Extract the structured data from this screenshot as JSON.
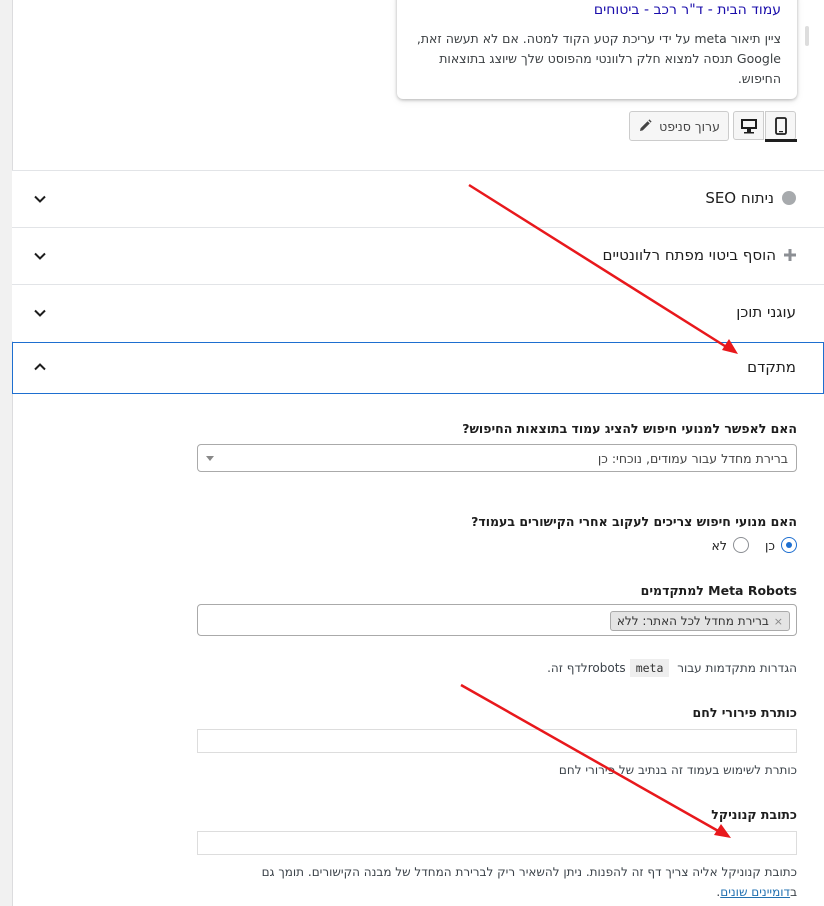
{
  "snippet": {
    "title": "עמוד הבית - ד\"ר רכב - ביטוחים",
    "description": "ציין תיאור meta על ידי עריכת קטע הקוד למטה. אם לא תעשה זאת, Google תנסה למצוא חלק רלוונטי מהפוסט שלך שיוצג בתוצאות החיפוש."
  },
  "toolbar": {
    "edit_snippet_label": "ערוך סניפט",
    "mobile_icon": "mobile-icon",
    "desktop_icon": "desktop-icon",
    "pencil_icon": "pencil-icon"
  },
  "accordion": {
    "seo": "ניתוח SEO",
    "keyphrase": "הוסף ביטוי מפתח רלוונטיים",
    "anchors": "עוגני תוכן",
    "advanced": "מתקדם"
  },
  "advanced": {
    "allow_index_label": "האם לאפשר למנועי חיפוש להציג עמוד בתוצאות החיפוש?",
    "allow_index_value": "ברירת מחדל עבור עמודים, נוכחי: כן",
    "follow_label": "האם מנועי חיפוש צריכים לעקוב אחרי הקישורים בעמוד?",
    "follow_yes": "כן",
    "follow_no": "לא",
    "meta_robots_label": "Meta Robots למתקדמים",
    "meta_robots_tag": "ברירת מחדל לכל האתר: ללא",
    "meta_robots_help_pre": "הגדרות מתקדמות עבור robots",
    "meta_robots_help_code": "meta",
    "meta_robots_help_post": "לדף זה.",
    "breadcrumb_label": "כותרת פירורי לחם",
    "breadcrumb_value": "",
    "breadcrumb_help": "כותרת לשימוש בעמוד זה בנתיב של פירורי לחם",
    "canonical_label": "כתובת קנוניקל",
    "canonical_value": "",
    "canonical_help_text": "כתובת קנוניקל אליה צריך דף זה להפנות. ניתן להשאיר ריק לברירת המחדל של מבנה הקישורים. תומך גם ב",
    "canonical_help_link": "דומיינים שונים",
    "canonical_help_end": "."
  },
  "colors": {
    "accent": "#1e6fd0",
    "link": "#1a0dab",
    "annotation_arrow": "#e8181c"
  }
}
